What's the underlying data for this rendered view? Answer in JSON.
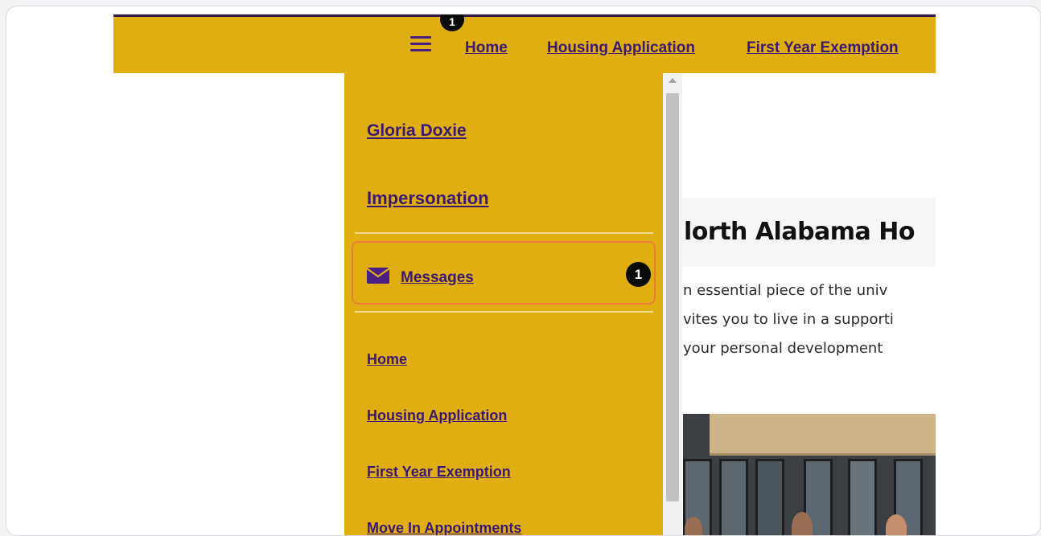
{
  "topnav": {
    "badge_count": "1",
    "links": [
      "Home",
      "Housing Application",
      "First Year Exemption"
    ]
  },
  "drawer": {
    "user_name": "Gloria Doxie",
    "impersonation": "Impersonation",
    "messages": {
      "label": "Messages",
      "count": "1"
    },
    "items": [
      "Home",
      "Housing Application",
      "First Year Exemption",
      "Move In Appointments"
    ]
  },
  "main": {
    "title": "lorth Alabama Ho",
    "paragraph_lines": [
      "n essential piece of the univ",
      "vites you to live in a supporti",
      " your personal development"
    ]
  },
  "colors": {
    "gold": "#e0ae10",
    "purple": "#3b1874",
    "highlight": "#f07b3a"
  }
}
